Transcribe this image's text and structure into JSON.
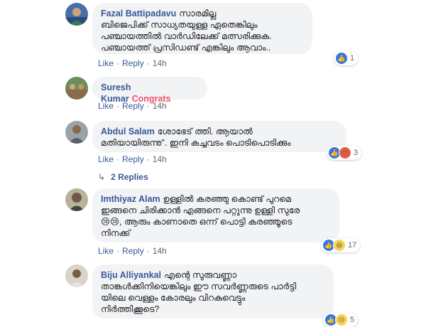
{
  "comments": [
    {
      "author": "Fazal Battipadavu",
      "text": "സാരമില്ല\nബിജെപിക്ക് സാധ്യതയുള്ള ഏതെങ്കിലും\nപഞ്ചായത്തിൽ വാർഡിലേക്ക് മത്സരിക്കുക.\nപഞ്ചായത്ത് പ്രസിഡണ്ട് എങ്കിലും ആവാം..",
      "like": "Like",
      "reply": "Reply",
      "time": "14h",
      "reaction_count": "1"
    },
    {
      "author": "Suresh Kumar",
      "text": "Congrats",
      "like": "Like",
      "reply": "Reply",
      "time": "14h"
    },
    {
      "author": "Abdul Salam",
      "text": "ശോഭേട് ത്തി. ആയാൽ\nമതിയായിരുന്നു\". ഇനി കച്ചവടം പൊടിപൊടിക്കും",
      "like": "Like",
      "reply": "Reply",
      "time": "14h",
      "reaction_count": "3"
    },
    {
      "author": "Imthiyaz Alam",
      "text": "ഉള്ളിൽ കരഞ്ഞു കൊണ്ട് പുറമെ\nഇങ്ങനെ ചിരിക്കാൻ എങ്ങനെ പറ്റുന്നു ഉള്ളി സുരേ\n😢😢, ആരും കാണാതെ ഒന്ന് പൊട്ടി കരഞ്ഞൂടെ\nനിനക്ക്",
      "like": "Like",
      "reply": "Reply",
      "time": "14h",
      "reaction_count": "17"
    },
    {
      "author": "Biju Alliyankal",
      "text": "എന്റെ സുരുവണ്ണാ\nതാങ്കൾക്കിനിയെങ്കിലും ഈ സവർണ്ണരുടെ പാർട്ടി\nയിലെ വെള്ളം കോരലും വിറകുവെട്ടും\nനിർത്തിക്കൂടെ?",
      "reaction_count": "5"
    }
  ],
  "replies_label": "2 Replies",
  "colors": {
    "link": "#385898",
    "bubble": "#f2f3f5",
    "congrats": "#f25268"
  }
}
